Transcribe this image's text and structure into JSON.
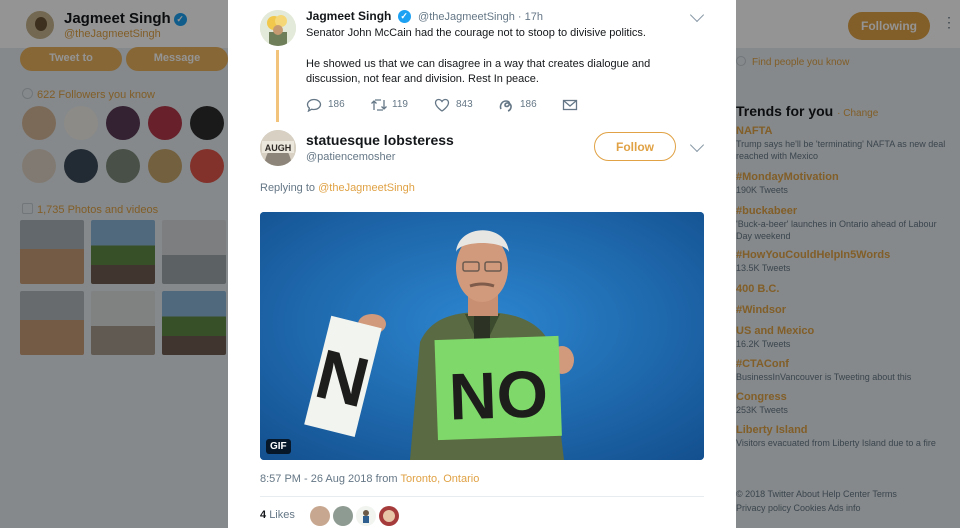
{
  "background_profile": {
    "name": "Jagmeet Singh",
    "handle": "@theJagmeetSingh",
    "following_label": "Following",
    "tweet_to_label": "Tweet to",
    "message_label": "Message",
    "followers_you_know": "622 Followers you know",
    "photos_and_videos": "1,735 Photos and videos",
    "find_people": "Find people you know"
  },
  "trends": {
    "title": "Trends for you",
    "change_label": "· Change",
    "items": [
      {
        "name": "NAFTA",
        "sub": "Trump says he'll be 'terminating' NAFTA as new deal reached with Mexico"
      },
      {
        "name": "#MondayMotivation",
        "sub": "190K Tweets"
      },
      {
        "name": "#buckabeer",
        "sub": "'Buck-a-beer' launches in Ontario ahead of Labour Day weekend"
      },
      {
        "name": "#HowYouCouldHelpIn5Words",
        "sub": "13.5K Tweets"
      },
      {
        "name": "400 B.C.",
        "sub": ""
      },
      {
        "name": "#Windsor",
        "sub": ""
      },
      {
        "name": "US and Mexico",
        "sub": "16.2K Tweets"
      },
      {
        "name": "#CTAConf",
        "sub": "BusinessInVancouver is Tweeting about this"
      },
      {
        "name": "Congress",
        "sub": "253K Tweets"
      },
      {
        "name": "Liberty Island",
        "sub": "Visitors evacuated from Liberty Island due to a fire"
      }
    ]
  },
  "footer": {
    "line1": "© 2018 Twitter   About   Help Center   Terms",
    "line2": "Privacy policy   Cookies   Ads info"
  },
  "parent_tweet": {
    "author": "Jagmeet Singh",
    "handle": "@theJagmeetSingh · 17h",
    "text1": "Senator John McCain had the courage not to stoop to divisive politics.",
    "text2": "He showed us that we can disagree in a way that creates dialogue and discussion, not fear and division. Rest In peace.",
    "replies": "186",
    "retweets": "119",
    "likes": "843",
    "extra": "186"
  },
  "reply_tweet": {
    "author": "statuesque lobsteress",
    "handle": "@patiencemosher",
    "follow_label": "Follow",
    "replying_prefix": "Replying to",
    "replying_to": "@theJagmeetSingh",
    "gif_label": "GIF",
    "sign_left": "N",
    "sign_right": "NO",
    "avatar_text": "AUGH",
    "timestamp": "8:57 PM - 26 Aug 2018 from",
    "location": "Toronto, Ontario",
    "likes_count": "4",
    "likes_label": "Likes"
  },
  "colors": {
    "accent": "#e0a245",
    "text": "#14171a",
    "muted": "#657786",
    "background": "#e6ecf0"
  }
}
